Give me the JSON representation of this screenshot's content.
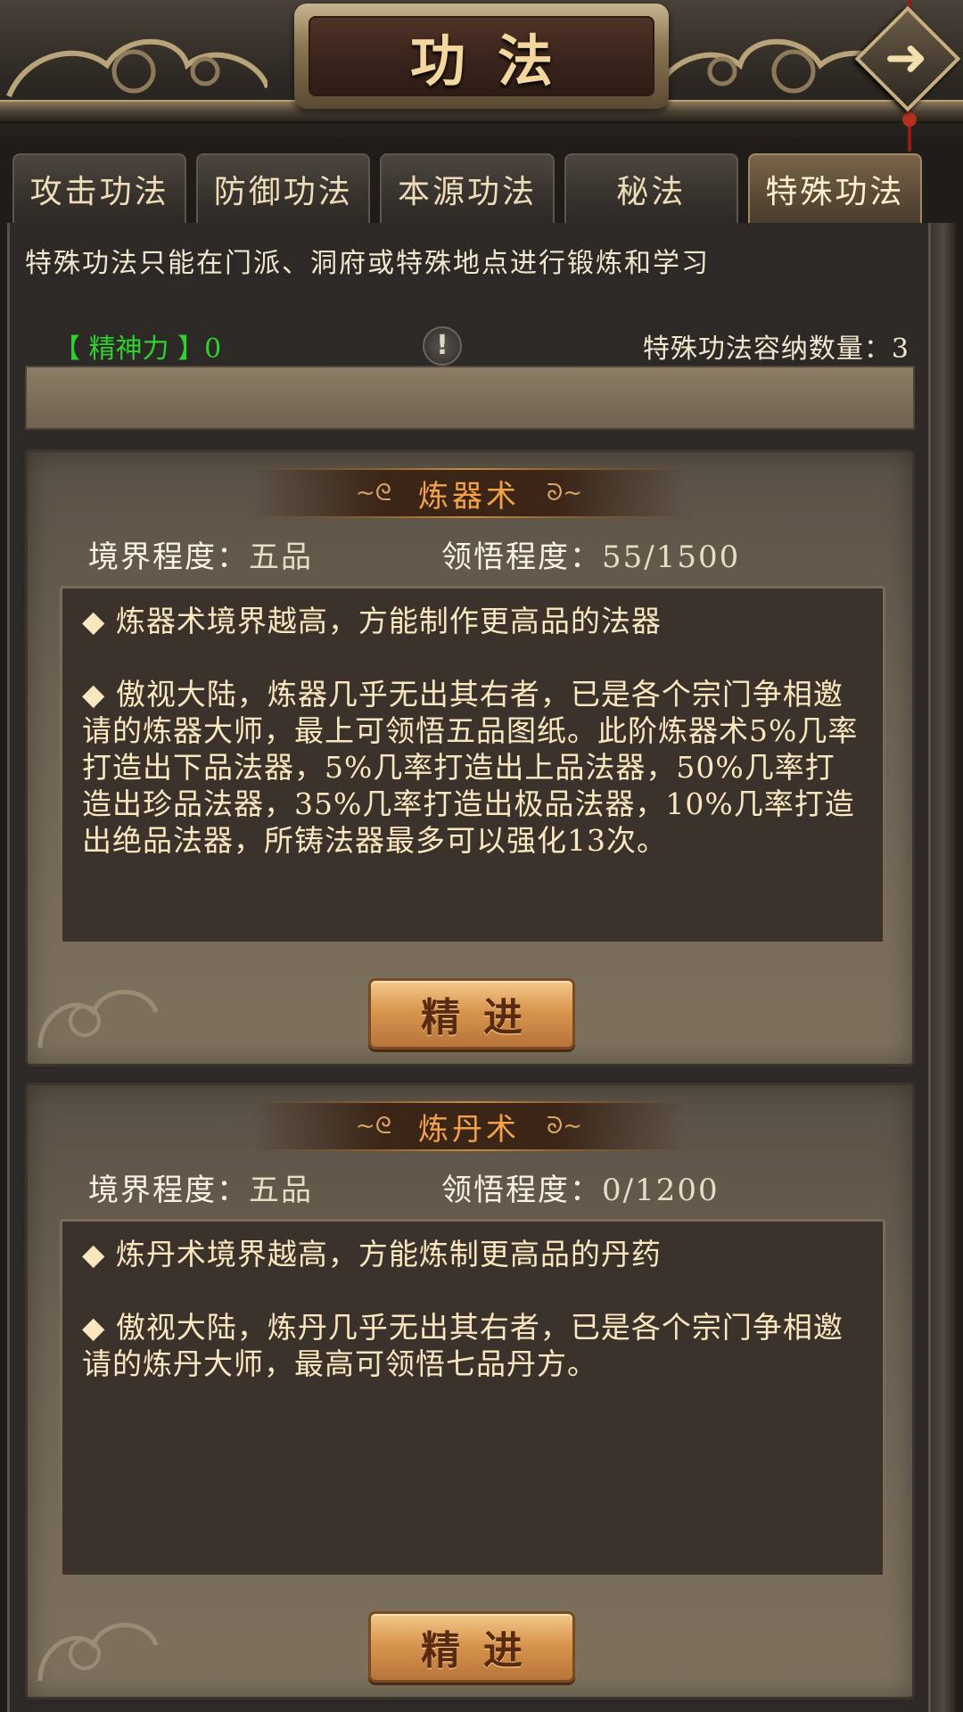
{
  "header": {
    "title": "功法",
    "back_icon": "arrow-right-icon"
  },
  "tabs": [
    {
      "label": "攻击功法",
      "active": false
    },
    {
      "label": "防御功法",
      "active": false
    },
    {
      "label": "本源功法",
      "active": false
    },
    {
      "label": "秘法",
      "active": false
    },
    {
      "label": "特殊功法",
      "active": true
    }
  ],
  "notice": "特殊功法只能在门派、洞府或特殊地点进行锻炼和学习",
  "stats": {
    "spirit_label": "【 精神力 】0",
    "warning_icon": "!",
    "capacity_label": "特殊功法容纳数量：3"
  },
  "skills": [
    {
      "name": "炼器术",
      "realm_label": "境界程度：",
      "realm_value": "五品",
      "comprehension_label": "领悟程度：",
      "comprehension_value": "55/1500",
      "desc_1": "◆ 炼器术境界越高，方能制作更高品的法器",
      "desc_2": "◆ 傲视大陆，炼器几乎无出其右者，已是各个宗门争相邀请的炼器大师，最上可领悟五品图纸。此阶炼器术5%几率打造出下品法器，5%几率打造出上品法器，50%几率打造出珍品法器，35%几率打造出极品法器，10%几率打造出绝品法器，所铸法器最多可以强化13次。",
      "button_label": "精进"
    },
    {
      "name": "炼丹术",
      "realm_label": "境界程度：",
      "realm_value": "五品",
      "comprehension_label": "领悟程度：",
      "comprehension_value": "0/1200",
      "desc_1": "◆ 炼丹术境界越高，方能炼制更高品的丹药",
      "desc_2": "◆ 傲视大陆，炼丹几乎无出其右者，已是各个宗门争相邀请的炼丹大师，最高可领悟七品丹方。",
      "button_label": "精进"
    }
  ],
  "colors": {
    "accent_gold": "#f4d79e",
    "spirit_green": "#2fd12f",
    "card_title_orange": "#f3a24a"
  }
}
